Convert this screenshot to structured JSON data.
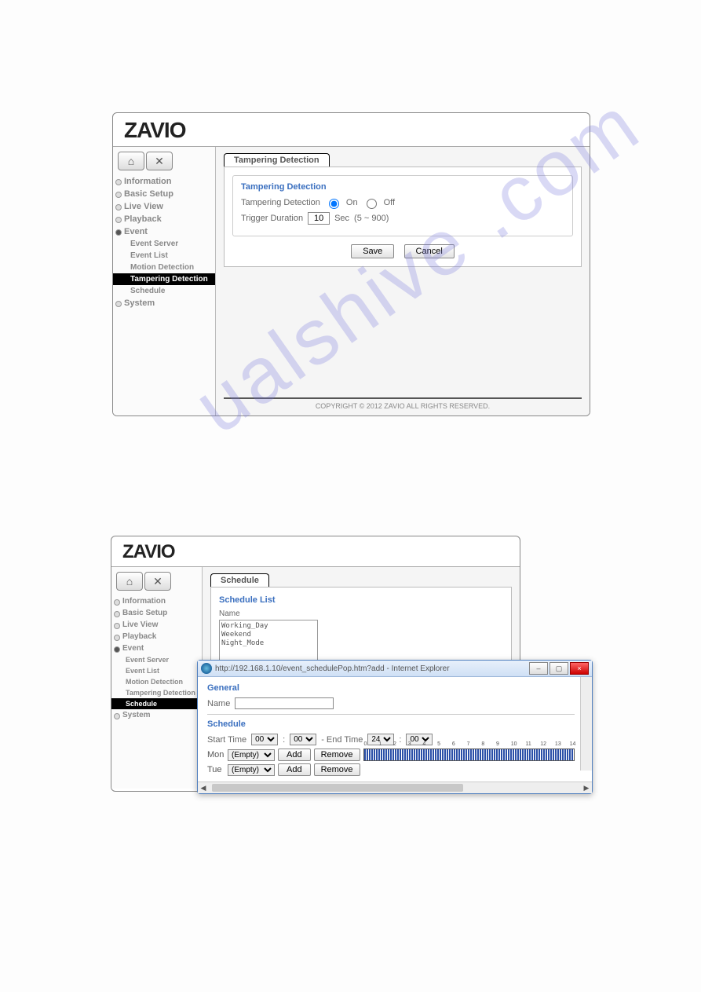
{
  "logo": "ZAVIO",
  "panelA": {
    "nav": [
      {
        "label": "Information"
      },
      {
        "label": "Basic Setup"
      },
      {
        "label": "Live View"
      },
      {
        "label": "Playback"
      },
      {
        "label": "Event",
        "expanded": true,
        "children": [
          {
            "label": "Event Server"
          },
          {
            "label": "Event List"
          },
          {
            "label": "Motion Detection"
          },
          {
            "label": "Tampering Detection",
            "active": true
          },
          {
            "label": "Schedule"
          }
        ]
      },
      {
        "label": "System"
      }
    ],
    "tab": "Tampering Detection",
    "section": "Tampering Detection",
    "tdLabel": "Tampering Detection",
    "optOn": "On",
    "optOff": "Off",
    "durLabel": "Trigger Duration",
    "durValue": "10",
    "durUnit": "Sec",
    "durRange": "(5 ~ 900)",
    "save": "Save",
    "cancel": "Cancel",
    "footer": "COPYRIGHT © 2012 ZAVIO ALL RIGHTS RESERVED."
  },
  "panelB": {
    "nav": [
      {
        "label": "Information"
      },
      {
        "label": "Basic Setup"
      },
      {
        "label": "Live View"
      },
      {
        "label": "Playback"
      },
      {
        "label": "Event",
        "expanded": true,
        "children": [
          {
            "label": "Event Server"
          },
          {
            "label": "Event List"
          },
          {
            "label": "Motion Detection"
          },
          {
            "label": "Tampering Detection"
          },
          {
            "label": "Schedule",
            "active": true
          }
        ]
      },
      {
        "label": "System"
      }
    ],
    "tab": "Schedule",
    "section": "Schedule List",
    "nameLabel": "Name",
    "items": [
      "Working_Day",
      "Weekend",
      "Night_Mode"
    ]
  },
  "popup": {
    "title": "http://192.168.1.10/event_schedulePop.htm?add - Internet Explorer",
    "general": "General",
    "nameLabel": "Name",
    "nameValue": "",
    "schedule": "Schedule",
    "startTime": "Start Time",
    "endTime": "- End Time",
    "sh": "00",
    "sm": "00",
    "eh": "24",
    "em": "00",
    "days": [
      "Mon",
      "Tue"
    ],
    "empty": "(Empty)",
    "add": "Add",
    "remove": "Remove",
    "ticks": [
      "0",
      "1",
      "2",
      "3",
      "4",
      "5",
      "6",
      "7",
      "8",
      "9",
      "10",
      "11",
      "12",
      "13",
      "14"
    ]
  },
  "watermark": "ualshive .com"
}
